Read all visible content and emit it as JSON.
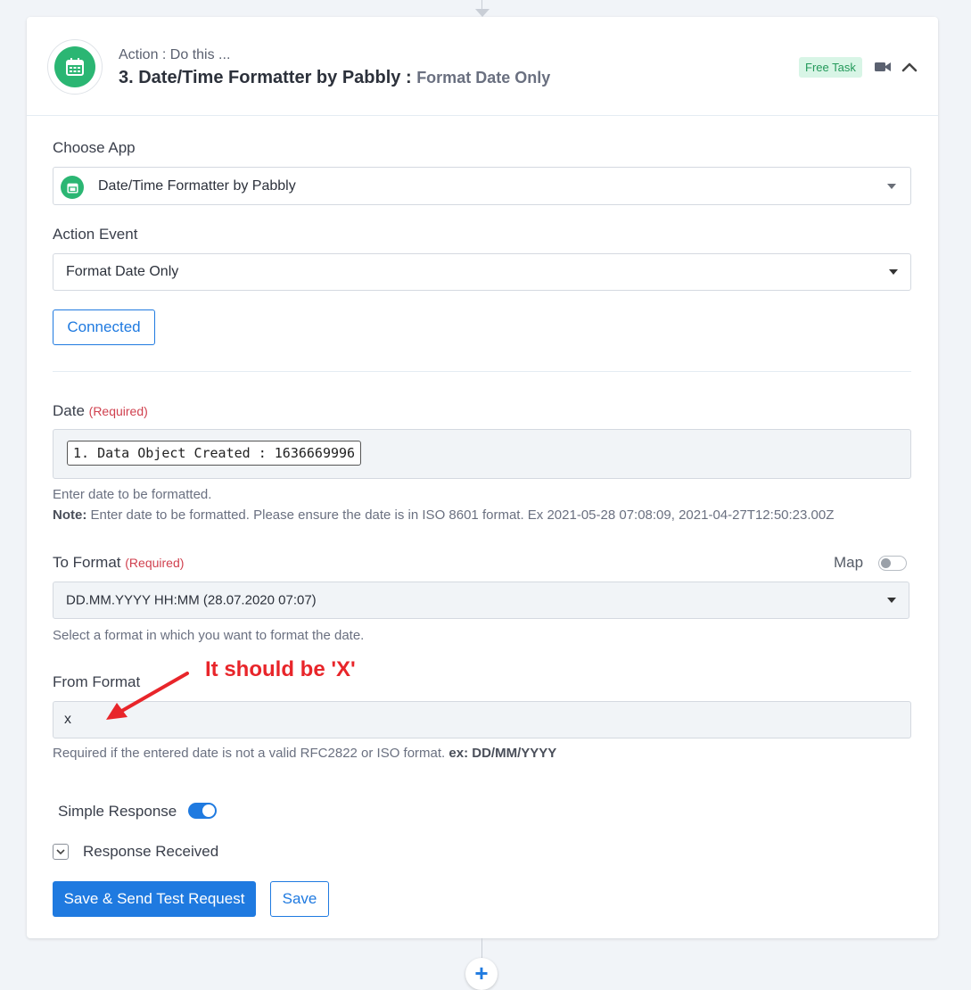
{
  "header": {
    "subtitle": "Action : Do this ...",
    "title": "3. Date/Time Formatter by Pabbly :",
    "event": "Format Date Only",
    "badge": "Free Task",
    "icons": [
      "calendar-icon",
      "video-icon",
      "chevron-up-icon"
    ]
  },
  "choose_app": {
    "label": "Choose App",
    "value": "Date/Time Formatter by Pabbly"
  },
  "action_event": {
    "label": "Action Event",
    "value": "Format Date Only"
  },
  "connected_button": "Connected",
  "date_field": {
    "label": "Date",
    "required": "(Required)",
    "chip": "1. Data Object Created : 1636669996",
    "help": "Enter date to be formatted.",
    "note_label": "Note:",
    "note": "Enter date to be formatted. Please ensure the date is in ISO 8601 format. Ex 2021-05-28 07:08:09, 2021-04-27T12:50:23.00Z"
  },
  "to_format": {
    "label": "To Format",
    "required": "(Required)",
    "map_label": "Map",
    "map_enabled": false,
    "value": "DD.MM.YYYY HH:MM (28.07.2020 07:07)",
    "help": "Select a format in which you want to format the date."
  },
  "from_format": {
    "label": "From Format",
    "value": "x",
    "help": "Required if the entered date is not a valid RFC2822 or ISO format.",
    "example": "ex: DD/MM/YYYY"
  },
  "annotation": {
    "text": "It should be 'X'",
    "color": "#e8252a"
  },
  "simple_response": {
    "label": "Simple Response",
    "enabled": true
  },
  "response_received": {
    "label": "Response Received"
  },
  "buttons": {
    "save_send": "Save & Send Test Request",
    "save": "Save"
  },
  "add_step": "+",
  "colors": {
    "accent": "#1f7ae0",
    "app_green": "#2bb673",
    "required_red": "#d0414f",
    "badge_bg": "#d8f5e6"
  }
}
